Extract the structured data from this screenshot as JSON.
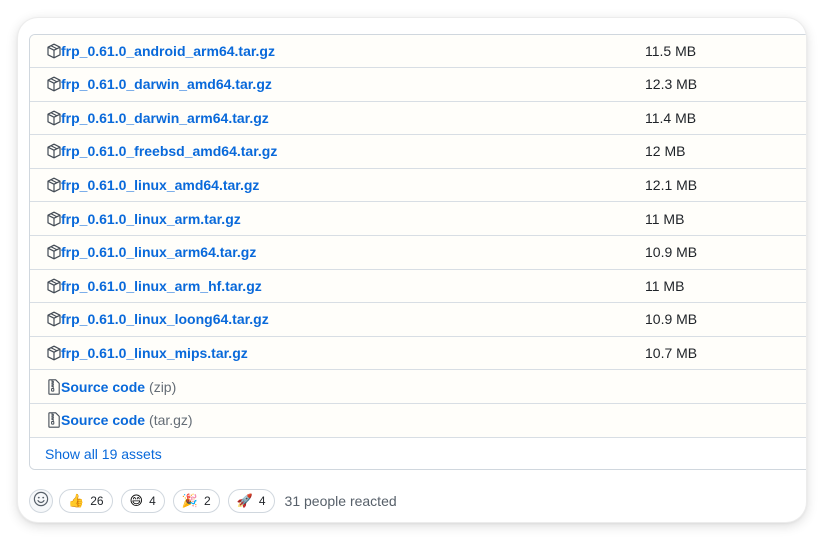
{
  "assets": [
    {
      "name": "frp_0.61.0_android_arm64.tar.gz",
      "size": "11.5 MB",
      "icon": "package-icon"
    },
    {
      "name": "frp_0.61.0_darwin_amd64.tar.gz",
      "size": "12.3 MB",
      "icon": "package-icon"
    },
    {
      "name": "frp_0.61.0_darwin_arm64.tar.gz",
      "size": "11.4 MB",
      "icon": "package-icon"
    },
    {
      "name": "frp_0.61.0_freebsd_amd64.tar.gz",
      "size": "12 MB",
      "icon": "package-icon"
    },
    {
      "name": "frp_0.61.0_linux_amd64.tar.gz",
      "size": "12.1 MB",
      "icon": "package-icon"
    },
    {
      "name": "frp_0.61.0_linux_arm.tar.gz",
      "size": "11 MB",
      "icon": "package-icon"
    },
    {
      "name": "frp_0.61.0_linux_arm64.tar.gz",
      "size": "10.9 MB",
      "icon": "package-icon"
    },
    {
      "name": "frp_0.61.0_linux_arm_hf.tar.gz",
      "size": "11 MB",
      "icon": "package-icon"
    },
    {
      "name": "frp_0.61.0_linux_loong64.tar.gz",
      "size": "10.9 MB",
      "icon": "package-icon"
    },
    {
      "name": "frp_0.61.0_linux_mips.tar.gz",
      "size": "10.7 MB",
      "icon": "package-icon"
    }
  ],
  "source_code": [
    {
      "label": "Source code",
      "suffix": "(zip)",
      "icon": "file-zip-icon"
    },
    {
      "label": "Source code",
      "suffix": "(tar.gz)",
      "icon": "file-zip-icon"
    }
  ],
  "show_all": "Show all 19 assets",
  "reactions": {
    "add_reaction_icon": "smiley-icon",
    "items": [
      {
        "emoji": "👍",
        "count": "26",
        "icon": "thumbs-up-icon"
      },
      {
        "emoji": "😄",
        "count": "4",
        "icon": "laugh-icon"
      },
      {
        "emoji": "🎉",
        "count": "2",
        "icon": "hooray-icon"
      },
      {
        "emoji": "🚀",
        "count": "4",
        "icon": "rocket-icon"
      }
    ],
    "summary": "31 people reacted"
  },
  "colors": {
    "link": "#0969da",
    "text": "#1f2328",
    "muted": "#656d76",
    "border": "#d0d7de"
  }
}
